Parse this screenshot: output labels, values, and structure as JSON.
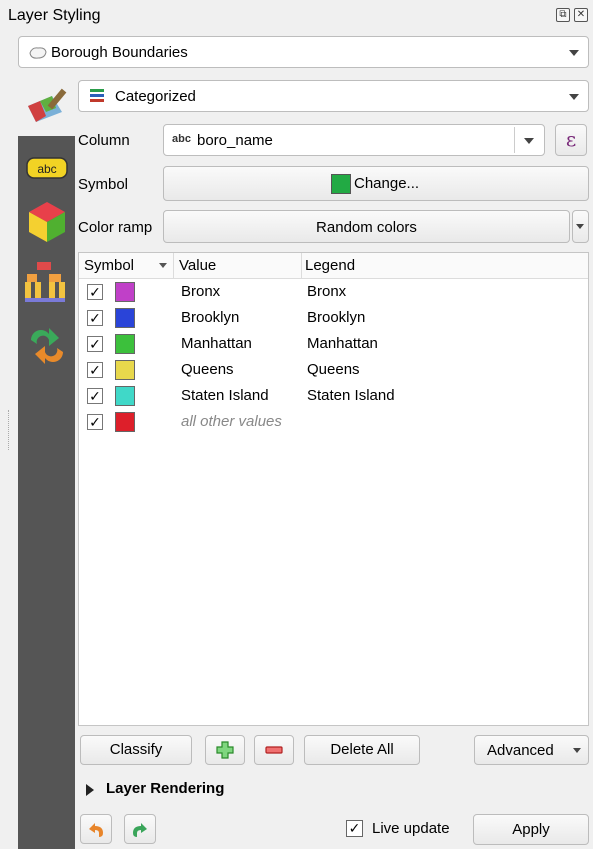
{
  "panel": {
    "title": "Layer Styling"
  },
  "layer_select": {
    "value": "Borough Boundaries"
  },
  "renderer_select": {
    "value": "Categorized"
  },
  "column": {
    "label": "Column",
    "type_badge": "abc",
    "value": "boro_name",
    "expr_symbol": "ε"
  },
  "symbol": {
    "label": "Symbol",
    "button_label": "Change...",
    "color": "#22aa44"
  },
  "color_ramp": {
    "label": "Color ramp",
    "value": "Random colors"
  },
  "table": {
    "headers": {
      "symbol": "Symbol",
      "value": "Value",
      "legend": "Legend"
    },
    "rows": [
      {
        "checked": "✓",
        "color": "#c040c8",
        "value": "Bronx",
        "legend": "Bronx"
      },
      {
        "checked": "✓",
        "color": "#2a44d8",
        "value": "Brooklyn",
        "legend": "Brooklyn"
      },
      {
        "checked": "✓",
        "color": "#3cc03c",
        "value": "Manhattan",
        "legend": "Manhattan"
      },
      {
        "checked": "✓",
        "color": "#e8d84c",
        "value": "Queens",
        "legend": "Queens"
      },
      {
        "checked": "✓",
        "color": "#40d8c8",
        "value": "Staten Island",
        "legend": "Staten Island"
      },
      {
        "checked": "✓",
        "color": "#dd1f2a",
        "value": "all other values",
        "legend": ""
      }
    ]
  },
  "actions": {
    "classify": "Classify",
    "add_icon": "plus-icon",
    "remove_icon": "minus-icon",
    "delete_all": "Delete All",
    "advanced": "Advanced"
  },
  "layer_rendering": {
    "label": "Layer Rendering"
  },
  "footer": {
    "live_update_label": "Live update",
    "live_update_check": "✓",
    "apply": "Apply"
  },
  "sidebar_icons": [
    "paintbrush-icon",
    "labels-icon",
    "3d-view-icon",
    "diagram-icon",
    "history-icon"
  ]
}
